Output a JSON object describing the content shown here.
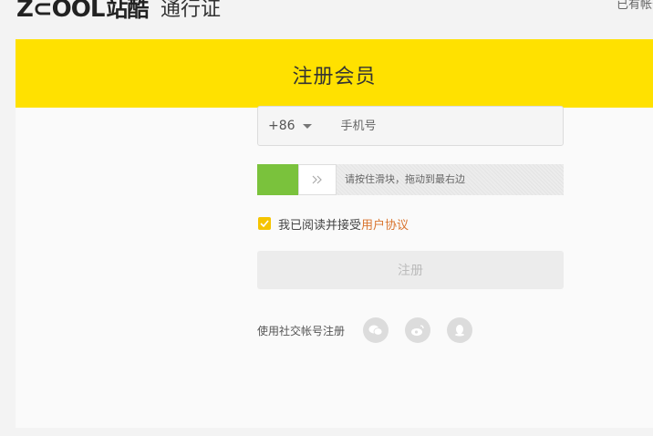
{
  "header": {
    "logo_text": "Z⊂OOL",
    "logo_cn": "站酷",
    "subtitle": "通行证",
    "login_prompt": "已有帐号"
  },
  "banner": {
    "title": "注册会员"
  },
  "form": {
    "country_code": "+86",
    "phone_placeholder": "手机号",
    "slider_hint": "请按住滑块，拖动到最右边",
    "agree_prefix": "我已阅读并接受",
    "agree_link": "用户协议",
    "register_label": "注册",
    "social_label": "使用社交帐号注册",
    "social_icons": [
      "wechat-icon",
      "weibo-icon",
      "qq-icon"
    ]
  },
  "colors": {
    "brand_yellow": "#ffe100",
    "slider_green": "#7ac23c",
    "link_orange": "#d9742e",
    "checkbox_yellow": "#f5c400"
  }
}
